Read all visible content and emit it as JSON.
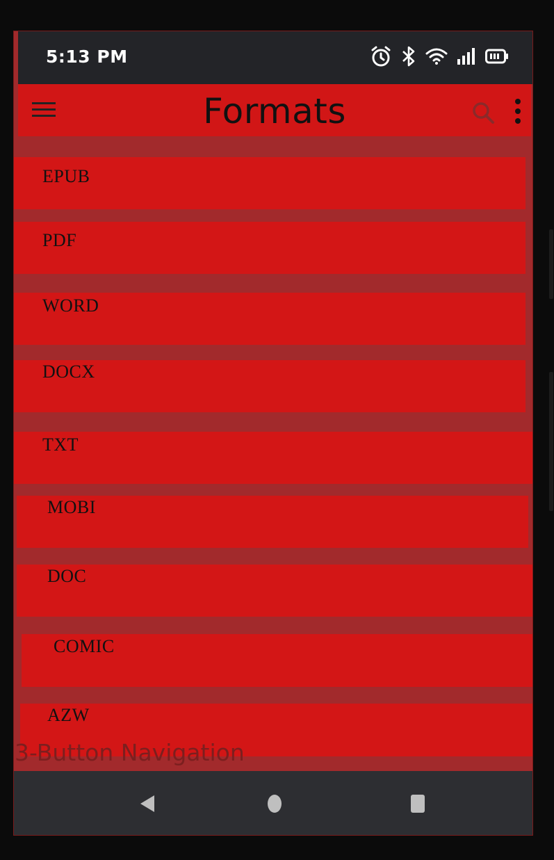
{
  "status_bar": {
    "time": "5:13 PM",
    "icons": [
      "alarm-icon",
      "bluetooth-icon",
      "wifi-icon",
      "signal-icon",
      "battery-icon"
    ]
  },
  "app_bar": {
    "title": "Formats",
    "icons": [
      "menu-icon",
      "search-icon",
      "more-vert-icon"
    ]
  },
  "formats": [
    {
      "label": "EPUB"
    },
    {
      "label": "PDF"
    },
    {
      "label": "WORD"
    },
    {
      "label": "DOCX"
    },
    {
      "label": "TXT"
    },
    {
      "label": "MOBI"
    },
    {
      "label": "DOC"
    },
    {
      "label": "COMIC"
    },
    {
      "label": "AZW"
    }
  ],
  "nav": {
    "hint_label": "3-Button Navigation",
    "buttons": [
      "back-icon",
      "home-icon",
      "recents-icon"
    ]
  },
  "colors": {
    "item_background": "#d31616",
    "screen_background": "#a22a2c",
    "status_bar": "#232428",
    "nav_bar": "#2d2e32"
  }
}
